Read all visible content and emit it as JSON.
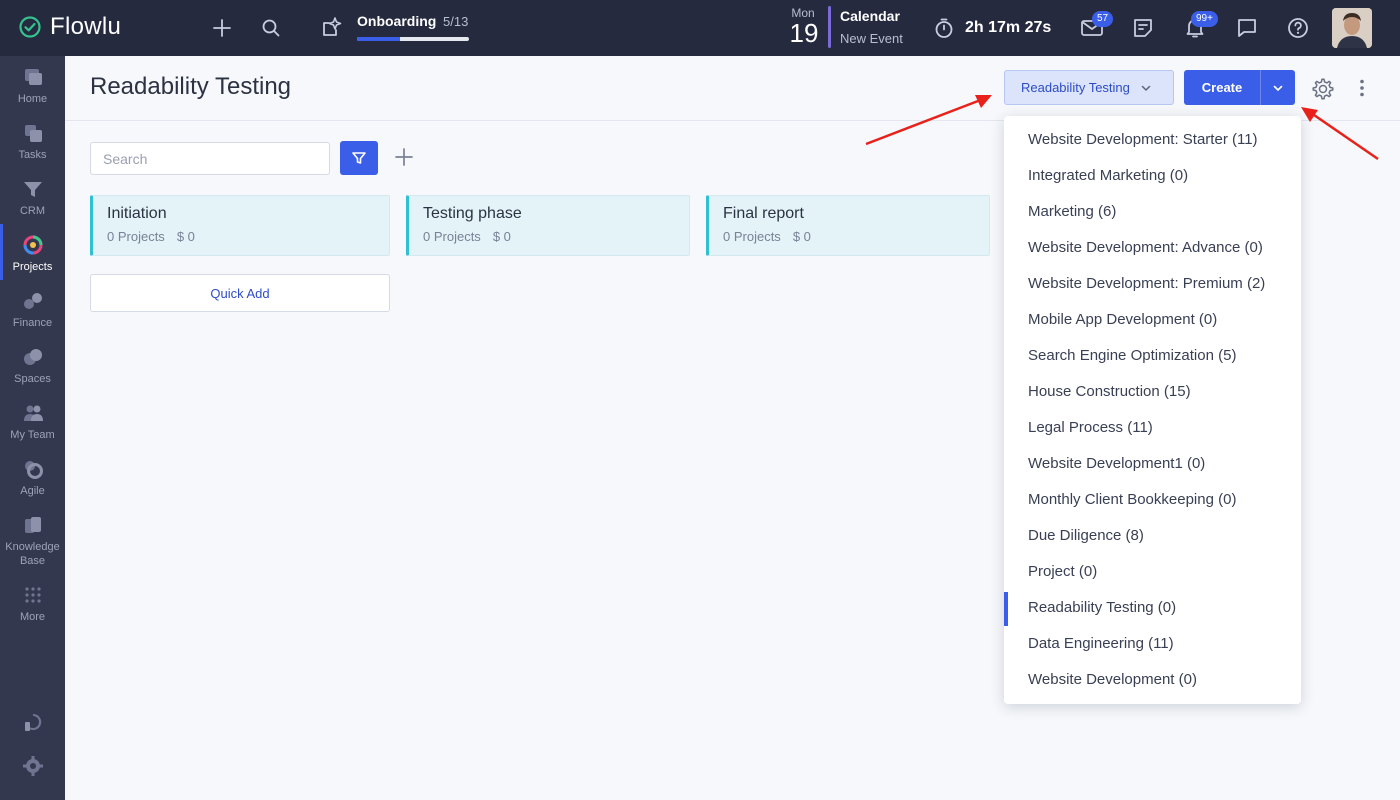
{
  "app": {
    "name": "Flowlu"
  },
  "topbar": {
    "onboarding": {
      "title": "Onboarding",
      "count": "5/13",
      "progress": 0.38
    },
    "date": {
      "day": "Mon",
      "num": "19"
    },
    "calendar": {
      "title": "Calendar",
      "subtitle": "New Event"
    },
    "timer": "2h 17m 27s",
    "mail_badge": "57",
    "notif_badge": "99+"
  },
  "sidebar": {
    "items": [
      {
        "label": "Home",
        "icon": "home-icon"
      },
      {
        "label": "Tasks",
        "icon": "tasks-icon"
      },
      {
        "label": "CRM",
        "icon": "crm-icon"
      },
      {
        "label": "Projects",
        "icon": "projects-icon",
        "active": true
      },
      {
        "label": "Finance",
        "icon": "finance-icon"
      },
      {
        "label": "Spaces",
        "icon": "spaces-icon"
      },
      {
        "label": "My Team",
        "icon": "team-icon"
      },
      {
        "label": "Agile",
        "icon": "agile-icon"
      },
      {
        "label": "Knowledge Base",
        "icon": "knowledge-base-icon"
      },
      {
        "label": "More",
        "icon": "grid-icon"
      }
    ]
  },
  "page": {
    "title": "Readability Testing",
    "pipeline_button": "Readability Testing",
    "create_button": "Create",
    "search_placeholder": "Search",
    "quick_add": "Quick Add"
  },
  "stages": [
    {
      "name": "Initiation",
      "projects": "0 Projects",
      "amount": "$ 0"
    },
    {
      "name": "Testing phase",
      "projects": "0 Projects",
      "amount": "$ 0"
    },
    {
      "name": "Final report",
      "projects": "0 Projects",
      "amount": "$ 0"
    }
  ],
  "dropdown": {
    "items": [
      "Website Development: Starter (11)",
      "Integrated Marketing (0)",
      "Marketing (6)",
      "Website Development: Advance (0)",
      "Website Development: Premium (2)",
      "Mobile App Development (0)",
      "Search Engine Optimization (5)",
      "House Construction (15)",
      "Legal Process (11)",
      "Website Development1 (0)",
      "Monthly Client Bookkeeping (0)",
      "Due Diligence (8)",
      "Project (0)",
      "Readability Testing (0)",
      "Data Engineering (11)",
      "Website Development (0)"
    ],
    "selected_index": 13
  },
  "colors": {
    "accent": "#3a5ee8",
    "topbar": "#262a3f",
    "sidebar": "#34384e",
    "stage": "#2fc0d3",
    "annotation": "#e8221b"
  }
}
